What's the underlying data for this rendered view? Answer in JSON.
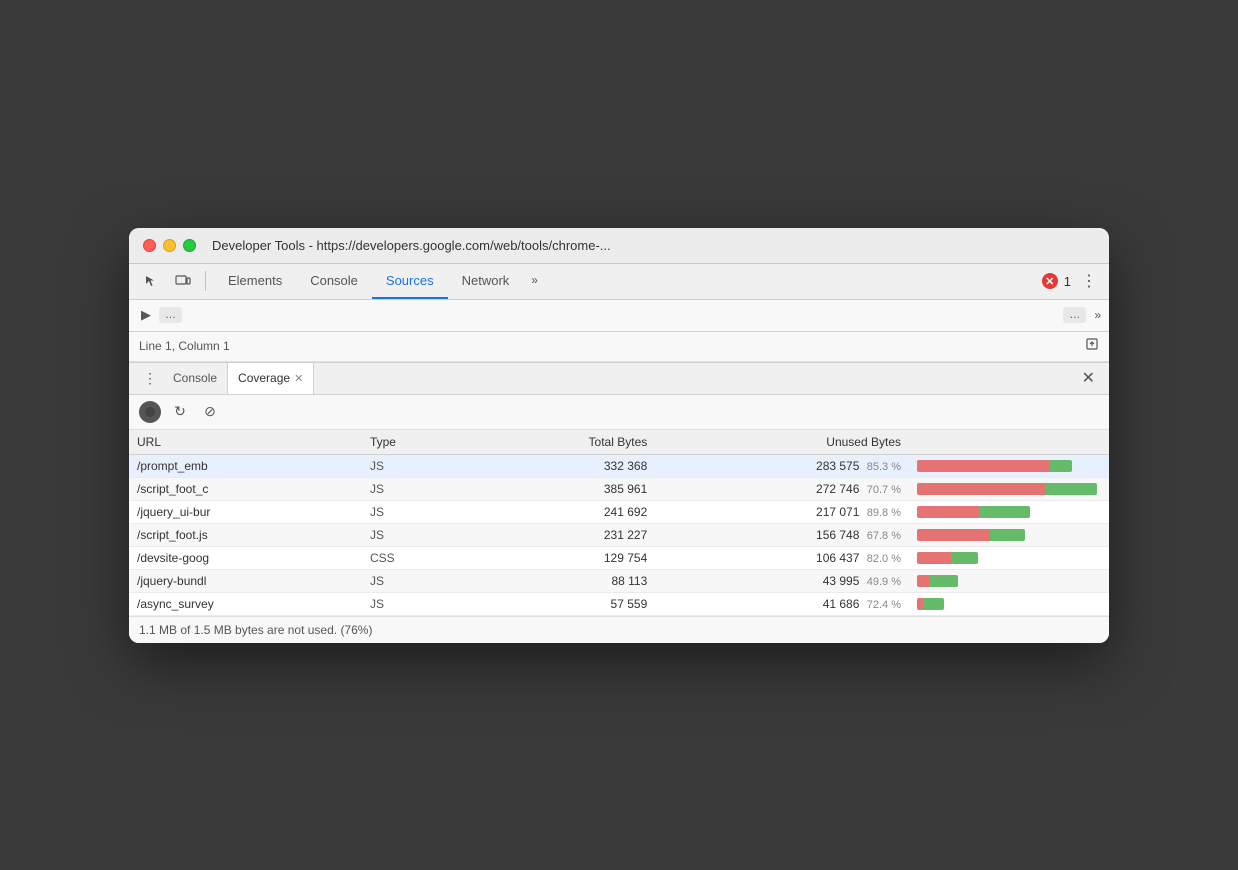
{
  "window": {
    "title": "Developer Tools - https://developers.google.com/web/tools/chrome-..."
  },
  "titlebar": {
    "traffic_lights": [
      "red",
      "yellow",
      "green"
    ],
    "title": "Developer Tools - https://developers.google.com/web/tools/chrome-..."
  },
  "toolbar": {
    "tabs": [
      {
        "label": "Elements",
        "active": false
      },
      {
        "label": "Console",
        "active": false
      },
      {
        "label": "Sources",
        "active": true
      },
      {
        "label": "Network",
        "active": false
      },
      {
        "label": "»",
        "active": false
      }
    ],
    "error_count": "1",
    "menu_label": "⋮"
  },
  "secondary": {
    "nav_icon": "▶",
    "breadcrumb": "Line 1, Column 1",
    "scroll_icon": "▲"
  },
  "drawer": {
    "menu_icon": "⋮",
    "tabs": [
      {
        "label": "Console",
        "active": false,
        "closable": false
      },
      {
        "label": "Coverage",
        "active": true,
        "closable": true
      }
    ],
    "close_icon": "✕"
  },
  "coverage": {
    "record_btn": "⏺",
    "reload_btn": "↻",
    "clear_btn": "⊘",
    "columns": [
      "URL",
      "Type",
      "Total Bytes",
      "Unused Bytes",
      ""
    ],
    "rows": [
      {
        "url": "/prompt_emb",
        "type": "JS",
        "total_bytes": "332 368",
        "unused_bytes": "283 575",
        "unused_pct": "85.3 %",
        "bar_red_pct": 85,
        "bar_green_pct": 15,
        "selected": true
      },
      {
        "url": "/script_foot_c",
        "type": "JS",
        "total_bytes": "385 961",
        "unused_bytes": "272 746",
        "unused_pct": "70.7 %",
        "bar_red_pct": 71,
        "bar_green_pct": 29,
        "selected": false
      },
      {
        "url": "/jquery_ui-bur",
        "type": "JS",
        "total_bytes": "241 692",
        "unused_bytes": "217 071",
        "unused_pct": "89.8 %",
        "bar_red_pct": 55,
        "bar_green_pct": 45,
        "selected": false
      },
      {
        "url": "/script_foot.js",
        "type": "JS",
        "total_bytes": "231 227",
        "unused_bytes": "156 748",
        "unused_pct": "67.8 %",
        "bar_red_pct": 68,
        "bar_green_pct": 32,
        "selected": false
      },
      {
        "url": "/devsite-goog",
        "type": "CSS",
        "total_bytes": "129 754",
        "unused_bytes": "106 437",
        "unused_pct": "82.0 %",
        "bar_red_pct": 55,
        "bar_green_pct": 45,
        "selected": false
      },
      {
        "url": "/jquery-bundl",
        "type": "JS",
        "total_bytes": "88 113",
        "unused_bytes": "43 995",
        "unused_pct": "49.9 %",
        "bar_red_pct": 30,
        "bar_green_pct": 70,
        "selected": false
      },
      {
        "url": "/async_survey",
        "type": "JS",
        "total_bytes": "57 559",
        "unused_bytes": "41 686",
        "unused_pct": "72.4 %",
        "bar_red_pct": 24,
        "bar_green_pct": 76,
        "selected": false
      }
    ],
    "footer": "1.1 MB of 1.5 MB bytes are not used. (76%)"
  }
}
